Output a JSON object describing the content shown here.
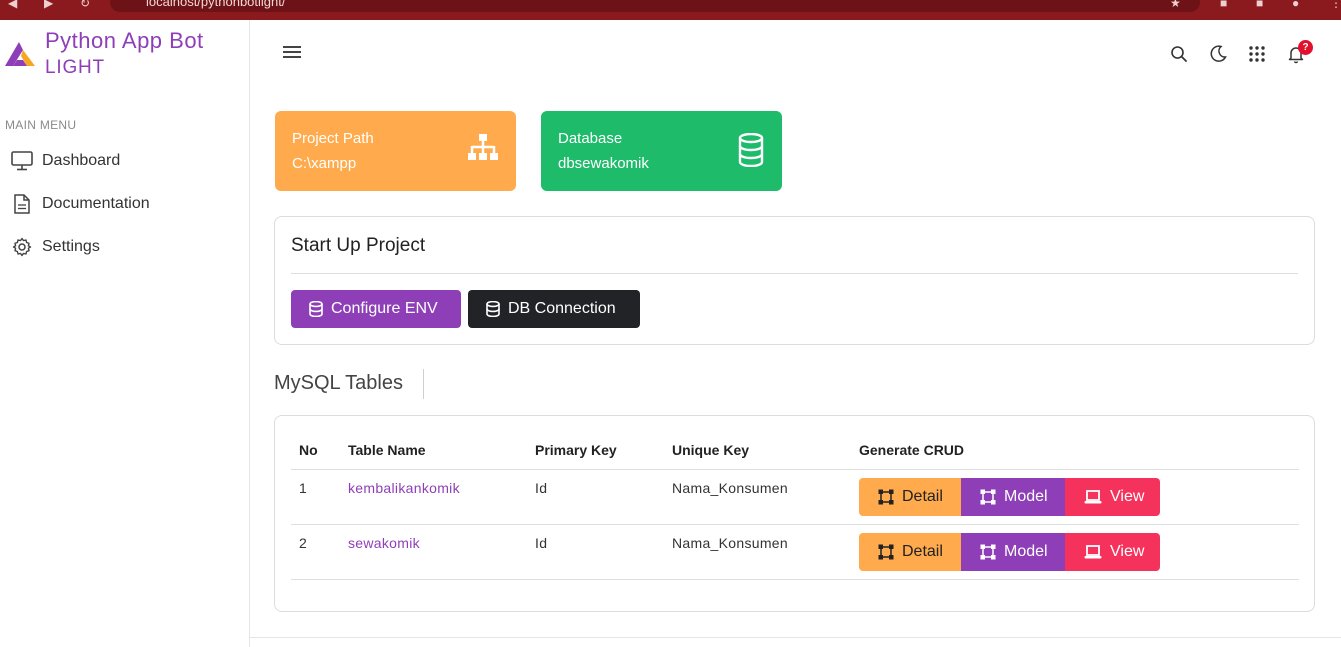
{
  "browser": {
    "url": "localhost/pythonbotlight/"
  },
  "brand": {
    "title": "Python App Bot",
    "subtitle": "LIGHT"
  },
  "sidebar": {
    "heading": "MAIN MENU",
    "items": [
      {
        "label": "Dashboard",
        "icon": "monitor-icon"
      },
      {
        "label": "Documentation",
        "icon": "document-icon"
      },
      {
        "label": "Settings",
        "icon": "gear-icon"
      }
    ]
  },
  "topbar": {
    "icons": [
      "search-icon",
      "moon-icon",
      "apps-grid-icon",
      "bell-icon"
    ],
    "notification_badge": "?"
  },
  "cards": {
    "project": {
      "label": "Project Path",
      "value": "C:\\xampp",
      "color": "#ffab4d",
      "icon": "sitemap-icon"
    },
    "database": {
      "label": "Database",
      "value": "dbsewakomik",
      "color": "#1dbb6a",
      "icon": "database-icon"
    }
  },
  "startup": {
    "title": "Start Up Project",
    "configure_label": "Configure ENV",
    "db_label": "DB Connection"
  },
  "tables_section": {
    "title": "MySQL Tables",
    "headers": [
      "No",
      "Table Name",
      "Primary Key",
      "Unique Key",
      "Generate CRUD"
    ],
    "rows": [
      {
        "no": "1",
        "name": "kembalikankomik",
        "primary_key": "Id",
        "unique_key": "Nama_Konsumen"
      },
      {
        "no": "2",
        "name": "sewakomik",
        "primary_key": "Id",
        "unique_key": "Nama_Konsumen"
      }
    ],
    "buttons": {
      "detail": "Detail",
      "model": "Model",
      "view": "View"
    }
  },
  "colors": {
    "accent": "#8e3fb8",
    "orange": "#ffab4d",
    "green": "#1dbb6a",
    "dark": "#212327",
    "pink": "#f5325c",
    "chrome": "#8b1a1f"
  }
}
